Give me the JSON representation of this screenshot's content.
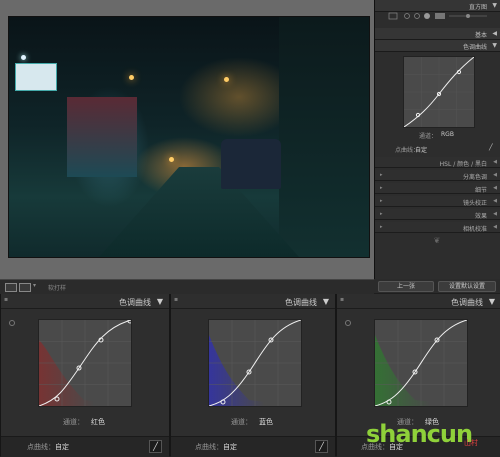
{
  "right_panel": {
    "histogram_title": "直方图",
    "basic_label": "基本",
    "tone_curve_label": "色调曲线",
    "channel_label": "通道：",
    "channel_value": "RGB",
    "point_curve_label": "点曲线：",
    "point_curve_value": "自定",
    "hsl_label": "HSL / 颜色 / 黑白",
    "sections": [
      "分离色调",
      "细节",
      "镜头校正",
      "效果",
      "相机校准"
    ],
    "prev_button": "上一张",
    "reset_button": "设置默认设置"
  },
  "toolbar": {
    "label": "软打样"
  },
  "panels": [
    {
      "title": "色调曲线",
      "channel_label": "通道：",
      "channel_value": "红色",
      "point_curve_label": "点曲线：",
      "point_curve_value": "自定",
      "color": "#8a2a2a"
    },
    {
      "title": "色调曲线",
      "channel_label": "通道：",
      "channel_value": "蓝色",
      "point_curve_label": "点曲线：",
      "point_curve_value": "自定",
      "color": "#2a2a9a"
    },
    {
      "title": "色调曲线",
      "channel_label": "通道：",
      "channel_value": "绿色",
      "point_curve_label": "点曲线：",
      "point_curve_value": "自定",
      "color": "#2a6a2a"
    }
  ],
  "watermark": {
    "text": "shancun",
    "sub": "山村"
  }
}
